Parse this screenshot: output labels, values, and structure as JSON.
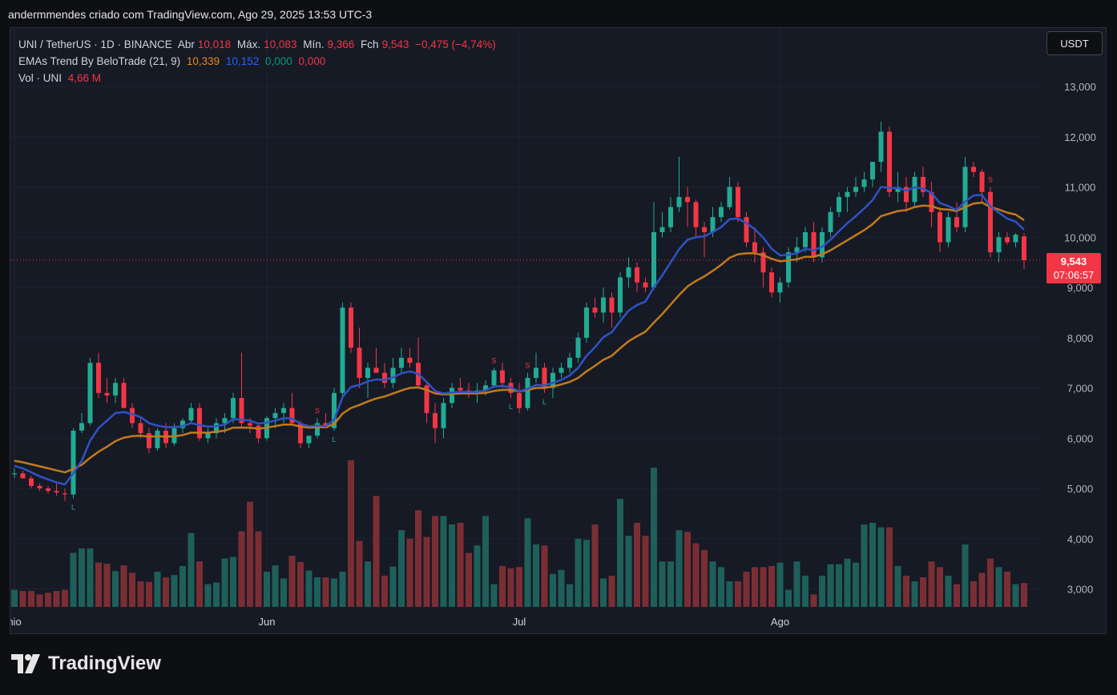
{
  "header": {
    "top_text": "andermmendes criado com TradingView.com, Ago 29, 2025 13:53 UTC-3"
  },
  "legend": {
    "symbol": "UNI / TetherUS · 1D · BINANCE",
    "open_label": "Abr",
    "open_value": "10,018",
    "high_label": "Máx.",
    "high_value": "10,083",
    "low_label": "Mín.",
    "low_value": "9,366",
    "close_label": "Fch",
    "close_value": "9,543",
    "change": "−0,475 (−4,74%)",
    "ema_name": "EMAs Trend By BeloTrade (21, 9)",
    "ema_v1": "10,339",
    "ema_v2": "10,152",
    "ema_v3": "0,000",
    "ema_v4": "0,000",
    "vol_name": "Vol · UNI",
    "vol_value": "4,66 M"
  },
  "currency_button": "USDT",
  "price_tag": {
    "price": "9,543",
    "countdown": "07:06:57"
  },
  "logo_text": "TradingView",
  "colors": {
    "up": "#22ab94",
    "down": "#f23645",
    "up_vol": "#1e5f5a",
    "down_vol": "#7a2e34",
    "ema_fast": "#2f52c6",
    "ema_slow": "#c27a1c",
    "bg": "#161a25",
    "grid": "#1f2330"
  },
  "chart_data": {
    "type": "candlestick",
    "ylim": [
      2700,
      13600
    ],
    "y_ticks": [
      "13,000",
      "12,000",
      "11,000",
      "10,000",
      "9,000",
      "8,000",
      "7,000",
      "6,000",
      "5,000",
      "4,000",
      "3,000"
    ],
    "y_tick_values": [
      13000,
      12000,
      11000,
      10000,
      9000,
      8000,
      7000,
      6000,
      5000,
      4000,
      3000
    ],
    "x_labels": [
      {
        "label": "nio",
        "index": 0
      },
      {
        "label": "Jun",
        "index": 30
      },
      {
        "label": "Jul",
        "index": 60
      },
      {
        "label": "Ago",
        "index": 91
      }
    ],
    "current_price": 9543,
    "candles": [
      [
        5.28,
        5.4,
        5.2,
        5.3
      ],
      [
        5.3,
        5.35,
        5.2,
        5.2
      ],
      [
        5.2,
        5.25,
        5.0,
        5.05
      ],
      [
        5.05,
        5.1,
        4.95,
        5.0
      ],
      [
        5.0,
        5.05,
        4.9,
        4.95
      ],
      [
        4.95,
        5.1,
        4.85,
        4.92
      ],
      [
        4.9,
        5.0,
        4.75,
        4.88
      ],
      [
        4.88,
        6.2,
        4.8,
        6.15
      ],
      [
        6.15,
        6.5,
        6.1,
        6.3
      ],
      [
        6.3,
        7.6,
        6.25,
        7.5
      ],
      [
        7.5,
        7.7,
        6.8,
        6.9
      ],
      [
        6.9,
        7.2,
        6.7,
        6.85
      ],
      [
        6.85,
        7.2,
        6.7,
        7.1
      ],
      [
        7.1,
        7.2,
        6.6,
        6.6
      ],
      [
        6.6,
        6.7,
        6.2,
        6.3
      ],
      [
        6.3,
        6.4,
        6.0,
        6.1
      ],
      [
        6.1,
        6.2,
        5.7,
        5.8
      ],
      [
        5.8,
        6.2,
        5.75,
        6.15
      ],
      [
        6.15,
        6.3,
        5.8,
        5.9
      ],
      [
        5.9,
        6.3,
        5.85,
        6.2
      ],
      [
        6.2,
        6.4,
        6.1,
        6.35
      ],
      [
        6.35,
        6.7,
        6.3,
        6.6
      ],
      [
        6.6,
        6.7,
        5.95,
        6.0
      ],
      [
        6.0,
        6.2,
        5.9,
        6.1
      ],
      [
        6.1,
        6.4,
        6.0,
        6.3
      ],
      [
        6.3,
        6.5,
        6.1,
        6.4
      ],
      [
        6.4,
        6.9,
        6.3,
        6.8
      ],
      [
        6.8,
        7.7,
        6.2,
        6.3
      ],
      [
        6.3,
        6.4,
        6.1,
        6.25
      ],
      [
        6.25,
        6.3,
        5.9,
        6.0
      ],
      [
        6.0,
        6.45,
        5.95,
        6.4
      ],
      [
        6.4,
        6.6,
        6.2,
        6.5
      ],
      [
        6.5,
        6.7,
        6.3,
        6.6
      ],
      [
        6.6,
        6.9,
        6.4,
        6.3
      ],
      [
        6.3,
        6.35,
        5.8,
        5.9
      ],
      [
        5.9,
        6.0,
        5.8,
        6.05
      ],
      [
        6.05,
        6.4,
        6.0,
        6.3
      ],
      [
        6.3,
        6.5,
        6.2,
        6.2
      ],
      [
        6.2,
        7.0,
        6.15,
        6.9
      ],
      [
        6.9,
        8.7,
        6.85,
        8.6
      ],
      [
        8.6,
        8.7,
        7.7,
        7.8
      ],
      [
        7.8,
        8.2,
        7.0,
        7.2
      ],
      [
        7.2,
        7.5,
        6.8,
        7.4
      ],
      [
        7.4,
        7.8,
        7.3,
        7.3
      ],
      [
        7.3,
        7.5,
        7.0,
        7.1
      ],
      [
        7.1,
        7.6,
        7.0,
        7.4
      ],
      [
        7.4,
        7.8,
        7.3,
        7.6
      ],
      [
        7.6,
        7.8,
        7.4,
        7.5
      ],
      [
        7.5,
        8.0,
        7.0,
        7.05
      ],
      [
        7.05,
        7.1,
        6.3,
        6.5
      ],
      [
        6.5,
        6.7,
        5.9,
        6.2
      ],
      [
        6.2,
        6.8,
        6.0,
        6.7
      ],
      [
        6.7,
        7.1,
        6.6,
        7.0
      ],
      [
        7.0,
        7.2,
        6.9,
        6.95
      ],
      [
        6.95,
        7.1,
        6.8,
        6.9
      ],
      [
        6.9,
        7.1,
        6.7,
        6.95
      ],
      [
        6.95,
        7.15,
        6.85,
        7.05
      ],
      [
        7.05,
        7.4,
        7.0,
        7.35
      ],
      [
        7.35,
        7.5,
        7.0,
        7.1
      ],
      [
        7.1,
        7.2,
        6.8,
        6.9
      ],
      [
        6.9,
        7.1,
        6.5,
        6.6
      ],
      [
        6.6,
        7.3,
        6.55,
        7.2
      ],
      [
        7.2,
        7.7,
        7.1,
        7.4
      ],
      [
        7.4,
        7.5,
        6.9,
        7.0
      ],
      [
        7.0,
        7.4,
        6.8,
        7.3
      ],
      [
        7.3,
        7.5,
        7.2,
        7.4
      ],
      [
        7.4,
        7.7,
        7.3,
        7.6
      ],
      [
        7.6,
        8.1,
        7.5,
        8.0
      ],
      [
        8.0,
        8.7,
        7.9,
        8.6
      ],
      [
        8.6,
        8.8,
        8.4,
        8.5
      ],
      [
        8.5,
        9.0,
        8.3,
        8.8
      ],
      [
        8.8,
        8.9,
        8.2,
        8.5
      ],
      [
        8.5,
        9.3,
        8.4,
        9.2
      ],
      [
        9.2,
        9.6,
        9.0,
        9.4
      ],
      [
        9.4,
        9.5,
        8.9,
        9.1
      ],
      [
        9.1,
        9.2,
        8.9,
        9.0
      ],
      [
        9.0,
        10.7,
        8.95,
        10.1
      ],
      [
        10.1,
        10.5,
        10.0,
        10.2
      ],
      [
        10.2,
        10.8,
        10.1,
        10.6
      ],
      [
        10.6,
        11.6,
        10.5,
        10.8
      ],
      [
        10.8,
        11.0,
        10.2,
        10.7
      ],
      [
        10.7,
        10.75,
        10.0,
        10.2
      ],
      [
        10.2,
        10.3,
        9.6,
        10.1
      ],
      [
        10.1,
        10.6,
        10.0,
        10.4
      ],
      [
        10.4,
        10.7,
        10.3,
        10.6
      ],
      [
        10.6,
        11.2,
        10.55,
        11.0
      ],
      [
        11.0,
        11.1,
        10.3,
        10.4
      ],
      [
        10.4,
        10.5,
        9.8,
        9.9
      ],
      [
        9.9,
        10.2,
        9.5,
        9.7
      ],
      [
        9.7,
        9.8,
        9.0,
        9.3
      ],
      [
        9.3,
        9.4,
        8.8,
        8.9
      ],
      [
        8.9,
        9.2,
        8.7,
        9.1
      ],
      [
        9.1,
        9.8,
        9.0,
        9.7
      ],
      [
        9.7,
        10.0,
        9.5,
        9.8
      ],
      [
        9.8,
        10.2,
        9.7,
        10.1
      ],
      [
        10.1,
        10.3,
        9.5,
        9.6
      ],
      [
        9.6,
        10.2,
        9.5,
        10.1
      ],
      [
        10.1,
        10.6,
        10.0,
        10.5
      ],
      [
        10.5,
        10.9,
        10.4,
        10.8
      ],
      [
        10.8,
        11.0,
        10.5,
        10.9
      ],
      [
        10.9,
        11.2,
        10.8,
        11.0
      ],
      [
        11.0,
        11.3,
        10.9,
        11.15
      ],
      [
        11.15,
        11.5,
        11.0,
        11.5
      ],
      [
        11.5,
        12.3,
        11.3,
        12.1
      ],
      [
        12.1,
        12.2,
        10.8,
        10.9
      ],
      [
        10.9,
        11.3,
        10.7,
        11.0
      ],
      [
        11.0,
        11.2,
        10.5,
        10.7
      ],
      [
        10.7,
        11.3,
        10.6,
        11.2
      ],
      [
        11.2,
        11.4,
        10.8,
        10.9
      ],
      [
        10.9,
        11.1,
        10.2,
        10.5
      ],
      [
        10.5,
        10.6,
        9.7,
        9.9
      ],
      [
        9.9,
        10.5,
        9.8,
        10.4
      ],
      [
        10.4,
        10.7,
        10.1,
        10.2
      ],
      [
        10.2,
        11.6,
        10.1,
        11.4
      ],
      [
        11.4,
        11.5,
        11.2,
        11.3
      ],
      [
        11.3,
        11.35,
        10.7,
        10.9
      ],
      [
        10.9,
        11.0,
        9.6,
        9.7
      ],
      [
        9.7,
        10.1,
        9.5,
        10.0
      ],
      [
        10.0,
        10.1,
        9.85,
        9.9
      ],
      [
        9.9,
        10.08,
        9.8,
        10.05
      ],
      [
        10.018,
        10.083,
        9.366,
        9.543
      ]
    ],
    "ema_fast": [
      5.45,
      5.4,
      5.32,
      5.24,
      5.18,
      5.12,
      5.08,
      5.3,
      5.55,
      5.95,
      6.2,
      6.35,
      6.5,
      6.52,
      6.48,
      6.42,
      6.3,
      6.25,
      6.22,
      6.22,
      6.24,
      6.3,
      6.26,
      6.23,
      6.24,
      6.27,
      6.38,
      6.37,
      6.35,
      6.29,
      6.31,
      6.35,
      6.4,
      6.39,
      6.29,
      6.24,
      6.25,
      6.24,
      6.37,
      6.82,
      7.02,
      7.06,
      7.13,
      7.17,
      7.16,
      7.21,
      7.29,
      7.33,
      7.28,
      7.12,
      6.94,
      6.89,
      6.91,
      6.92,
      6.92,
      6.92,
      6.95,
      7.03,
      7.04,
      7.01,
      6.93,
      6.98,
      7.06,
      7.05,
      7.1,
      7.16,
      7.25,
      7.4,
      7.64,
      7.81,
      8.01,
      8.11,
      8.33,
      8.54,
      8.65,
      8.72,
      9.0,
      9.24,
      9.5,
      9.76,
      9.95,
      10.0,
      10.02,
      10.1,
      10.2,
      10.36,
      10.37,
      10.28,
      10.16,
      9.99,
      9.77,
      9.64,
      9.65,
      9.68,
      9.77,
      9.74,
      9.81,
      9.95,
      10.12,
      10.28,
      10.42,
      10.57,
      10.74,
      11.0,
      10.98,
      10.98,
      10.93,
      10.99,
      10.97,
      10.88,
      10.68,
      10.62,
      10.54,
      10.71,
      10.83,
      10.84,
      10.61,
      10.49,
      10.37,
      10.31,
      10.15
    ],
    "ema_slow": [
      5.55,
      5.52,
      5.48,
      5.44,
      5.4,
      5.36,
      5.32,
      5.39,
      5.47,
      5.61,
      5.73,
      5.83,
      5.94,
      6.01,
      6.04,
      6.05,
      6.03,
      6.04,
      6.03,
      6.04,
      6.06,
      6.11,
      6.11,
      6.11,
      6.13,
      6.15,
      6.21,
      6.21,
      6.21,
      6.19,
      6.21,
      6.24,
      6.27,
      6.27,
      6.23,
      6.21,
      6.22,
      6.22,
      6.28,
      6.49,
      6.6,
      6.66,
      6.73,
      6.79,
      6.83,
      6.89,
      6.95,
      7.0,
      7.01,
      6.96,
      6.89,
      6.87,
      6.88,
      6.89,
      6.89,
      6.89,
      6.9,
      6.94,
      6.96,
      6.96,
      6.93,
      6.96,
      7.0,
      7.0,
      7.03,
      7.07,
      7.12,
      7.2,
      7.33,
      7.44,
      7.56,
      7.64,
      7.79,
      7.93,
      8.03,
      8.12,
      8.3,
      8.47,
      8.66,
      8.85,
      9.02,
      9.13,
      9.22,
      9.33,
      9.45,
      9.59,
      9.66,
      9.68,
      9.68,
      9.64,
      9.57,
      9.52,
      9.54,
      9.56,
      9.61,
      9.61,
      9.66,
      9.74,
      9.84,
      9.94,
      10.04,
      10.14,
      10.26,
      10.42,
      10.47,
      10.52,
      10.54,
      10.6,
      10.63,
      10.62,
      10.56,
      10.55,
      10.52,
      10.6,
      10.67,
      10.69,
      10.6,
      10.55,
      10.49,
      10.45,
      10.34
    ],
    "volume": [
      0.3,
      0.28,
      0.28,
      0.22,
      0.25,
      0.28,
      0.3,
      0.95,
      1.03,
      1.03,
      0.78,
      0.76,
      0.63,
      0.73,
      0.6,
      0.45,
      0.44,
      0.62,
      0.52,
      0.56,
      0.72,
      1.3,
      0.8,
      0.4,
      0.43,
      0.85,
      0.88,
      1.33,
      1.85,
      1.33,
      0.62,
      0.73,
      0.5,
      0.9,
      0.79,
      0.64,
      0.52,
      0.52,
      0.5,
      0.62,
      2.58,
      1.16,
      0.8,
      1.95,
      0.55,
      0.71,
      1.35,
      1.2,
      1.7,
      1.23,
      1.6,
      1.6,
      1.45,
      1.48,
      0.95,
      1.08,
      1.6,
      0.4,
      0.72,
      0.68,
      0.7,
      1.56,
      1.1,
      1.08,
      0.58,
      0.65,
      0.4,
      1.2,
      1.18,
      1.45,
      0.5,
      0.55,
      1.9,
      1.25,
      1.48,
      1.25,
      2.45,
      0.8,
      0.8,
      1.35,
      1.32,
      1.12,
      1.0,
      0.8,
      0.7,
      0.45,
      0.45,
      0.62,
      0.7,
      0.7,
      0.72,
      0.78,
      0.3,
      0.8,
      0.55,
      0.22,
      0.55,
      0.75,
      0.75,
      0.85,
      0.78,
      1.45,
      1.48,
      1.4,
      1.4,
      0.72,
      0.55,
      0.45,
      0.52,
      0.8,
      0.7,
      0.55,
      0.4,
      1.1,
      0.45,
      0.6,
      0.85,
      0.7,
      0.62,
      0.4,
      0.42
    ],
    "markers": [
      {
        "index": 7,
        "text": "L"
      },
      {
        "index": 36,
        "text": "S"
      },
      {
        "index": 38,
        "text": "L"
      },
      {
        "index": 57,
        "text": "S"
      },
      {
        "index": 59,
        "text": "L"
      },
      {
        "index": 61,
        "text": "S"
      },
      {
        "index": 63,
        "text": "L"
      },
      {
        "index": 116,
        "text": "S"
      }
    ]
  }
}
